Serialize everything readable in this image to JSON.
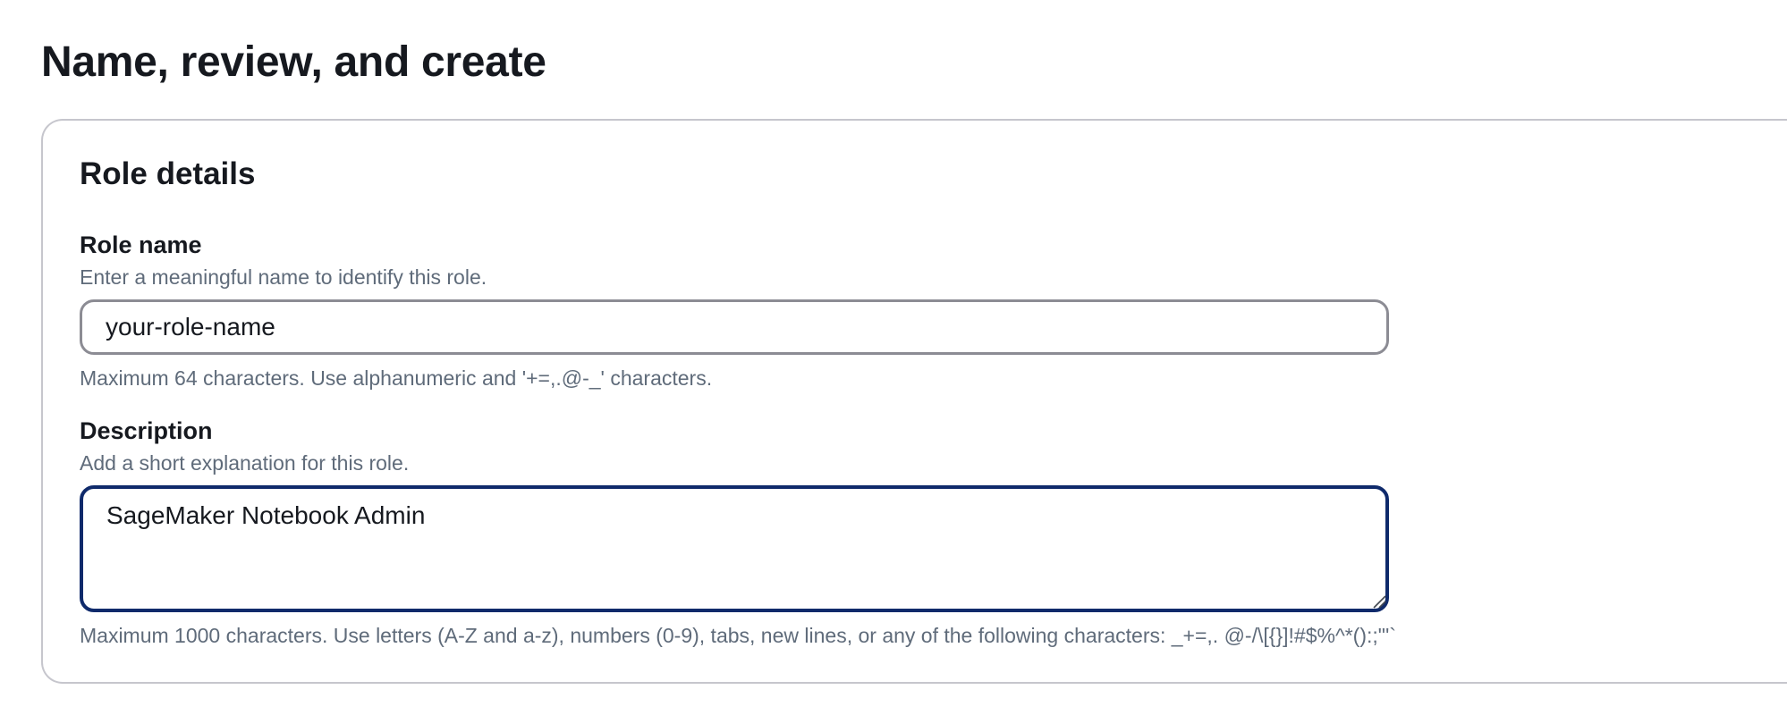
{
  "page": {
    "title": "Name, review, and create"
  },
  "role_details": {
    "title": "Role details",
    "role_name": {
      "label": "Role name",
      "description": "Enter a meaningful name to identify this role.",
      "value": "your-role-name",
      "constraint": "Maximum 64 characters. Use alphanumeric and '+=,.@-_' characters."
    },
    "description": {
      "label": "Description",
      "description": "Add a short explanation for this role.",
      "value": "SageMaker Notebook Admin",
      "constraint": "Maximum 1000 characters. Use letters (A-Z and a-z), numbers (0-9), tabs, new lines, or any of the following characters: _+=,. @-/\\[{}]!#$%^*():;\"'`"
    }
  },
  "colors": {
    "text": "#16191f",
    "secondary_text": "#5f6b7a",
    "container_border": "#c6c6cd",
    "input_border": "#8c8c94",
    "focused_border": "#0f2a6b"
  }
}
